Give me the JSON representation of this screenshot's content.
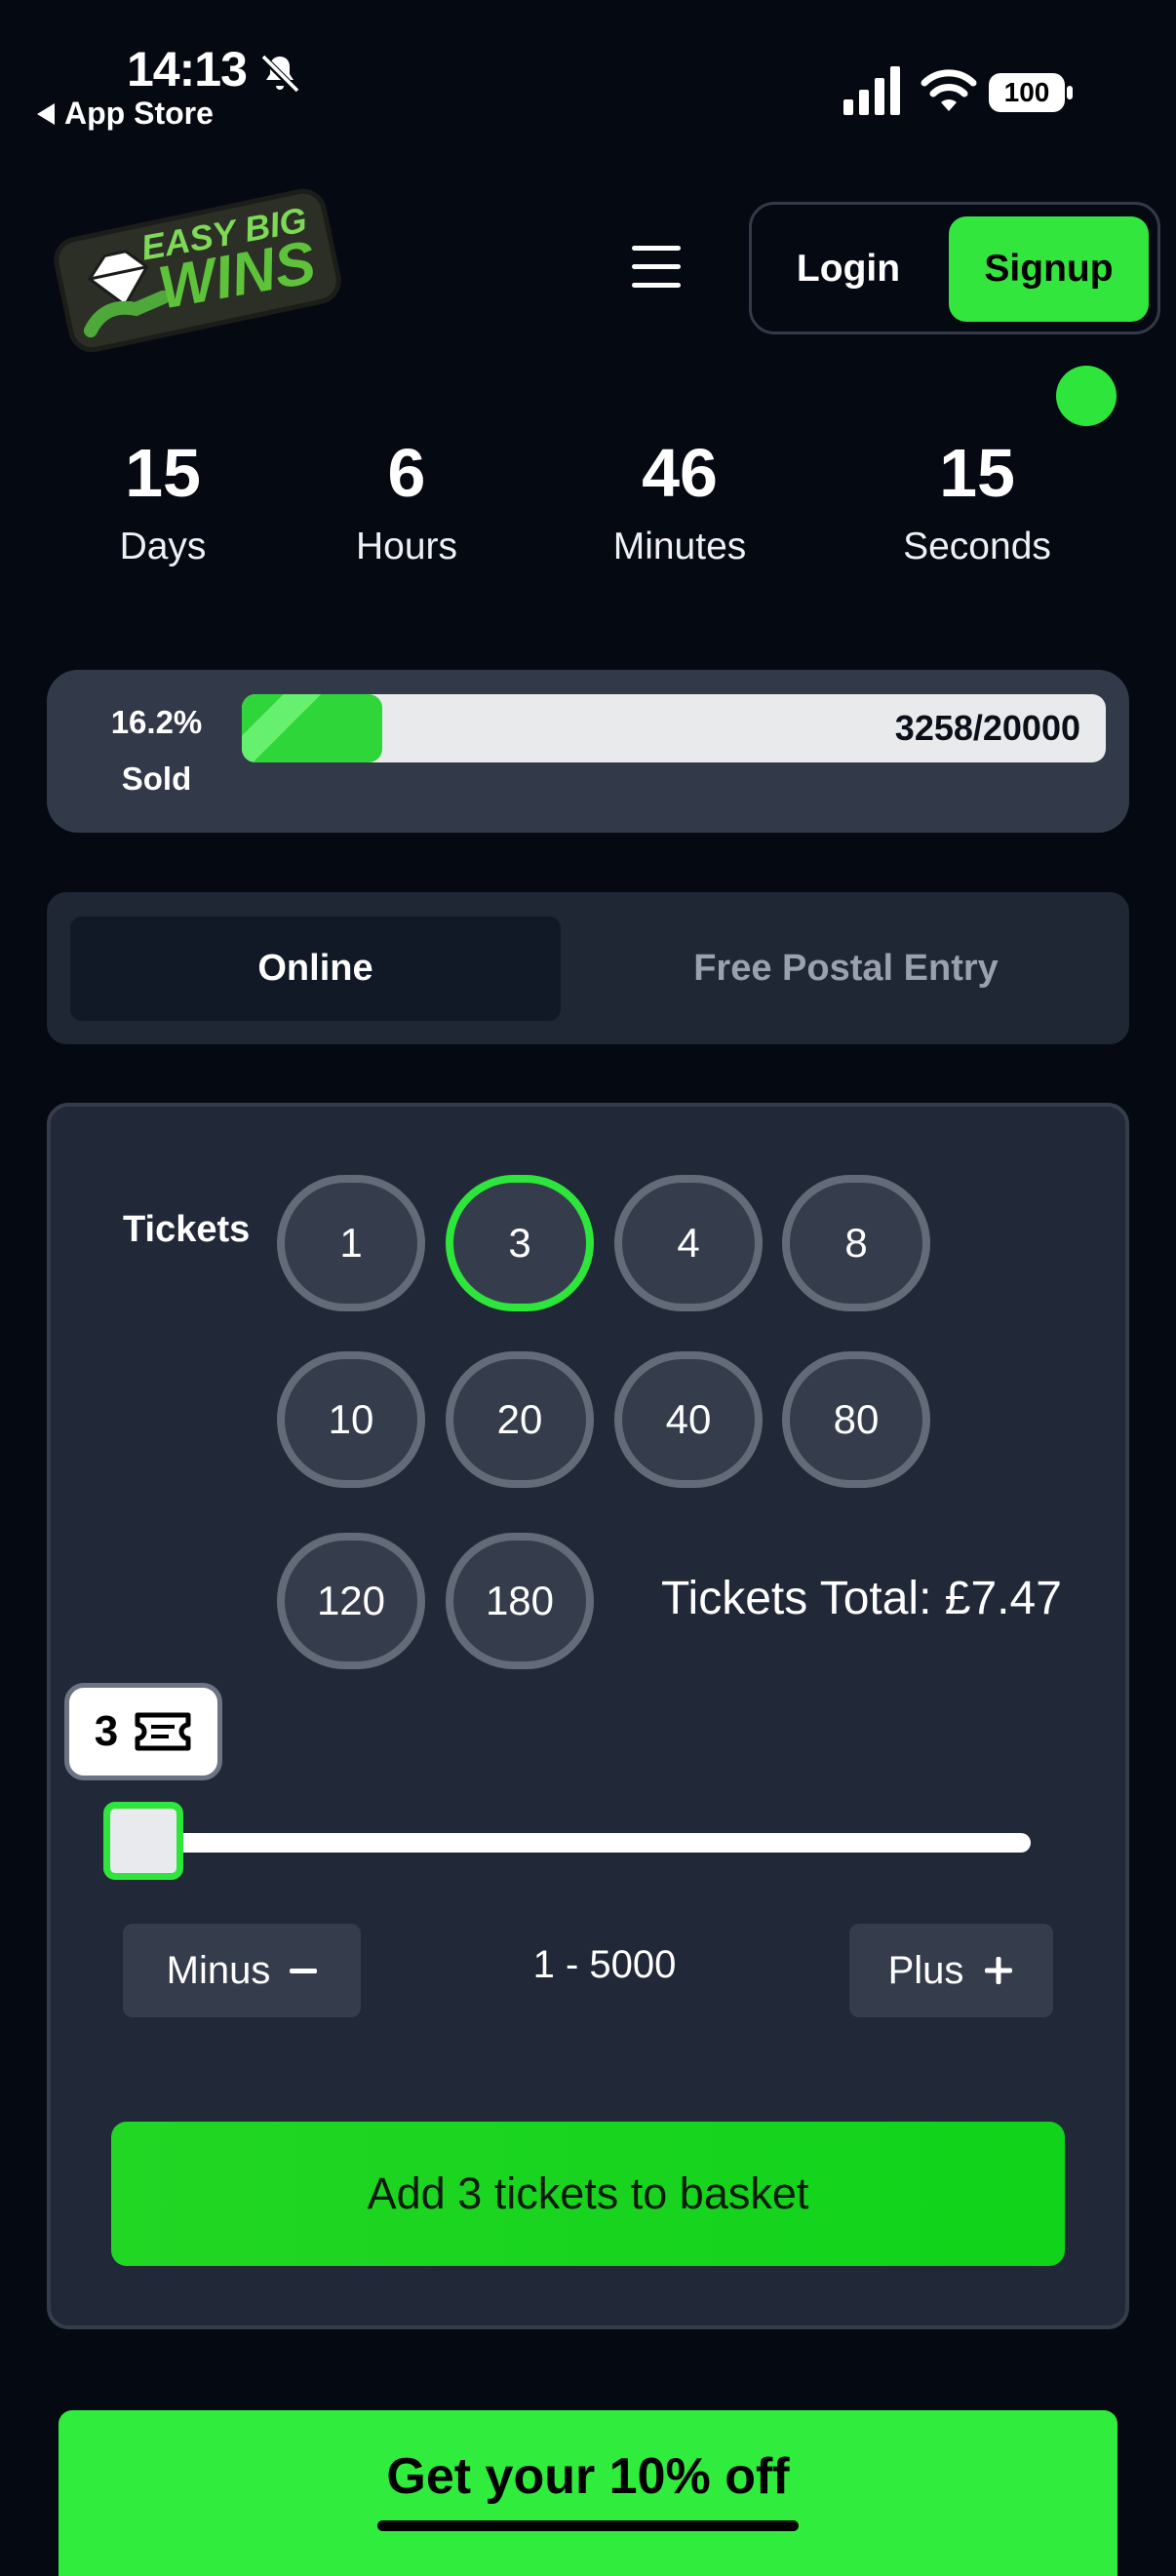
{
  "status_bar": {
    "time": "14:13",
    "back_label": "App Store",
    "battery": "100"
  },
  "header": {
    "logo_text_top": "EASY BIG",
    "logo_text_bottom": "WINS",
    "login_label": "Login",
    "signup_label": "Signup"
  },
  "countdown": [
    {
      "value": "15",
      "label": "Days"
    },
    {
      "value": "6",
      "label": "Hours"
    },
    {
      "value": "46",
      "label": "Minutes"
    },
    {
      "value": "15",
      "label": "Seconds"
    }
  ],
  "progress": {
    "percent_label": "16.2%",
    "sold_label": "Sold",
    "count_label": "3258/20000",
    "fraction": 0.162
  },
  "entry_tabs": {
    "online": "Online",
    "postal": "Free Postal Entry"
  },
  "tickets": {
    "label": "Tickets",
    "options": [
      "1",
      "3",
      "4",
      "8",
      "10",
      "20",
      "40",
      "80",
      "120",
      "180"
    ],
    "selected": "3",
    "total_label": "Tickets Total: £7.47",
    "quantity": "3",
    "minus_label": "Minus",
    "plus_label": "Plus",
    "range_label": "1 - 5000",
    "add_button": "Add 3 tickets to basket"
  },
  "promo": {
    "text": "Get your 10% off"
  },
  "colors": {
    "accent_green": "#33e63e",
    "background": "#050912",
    "card": "#212938"
  }
}
